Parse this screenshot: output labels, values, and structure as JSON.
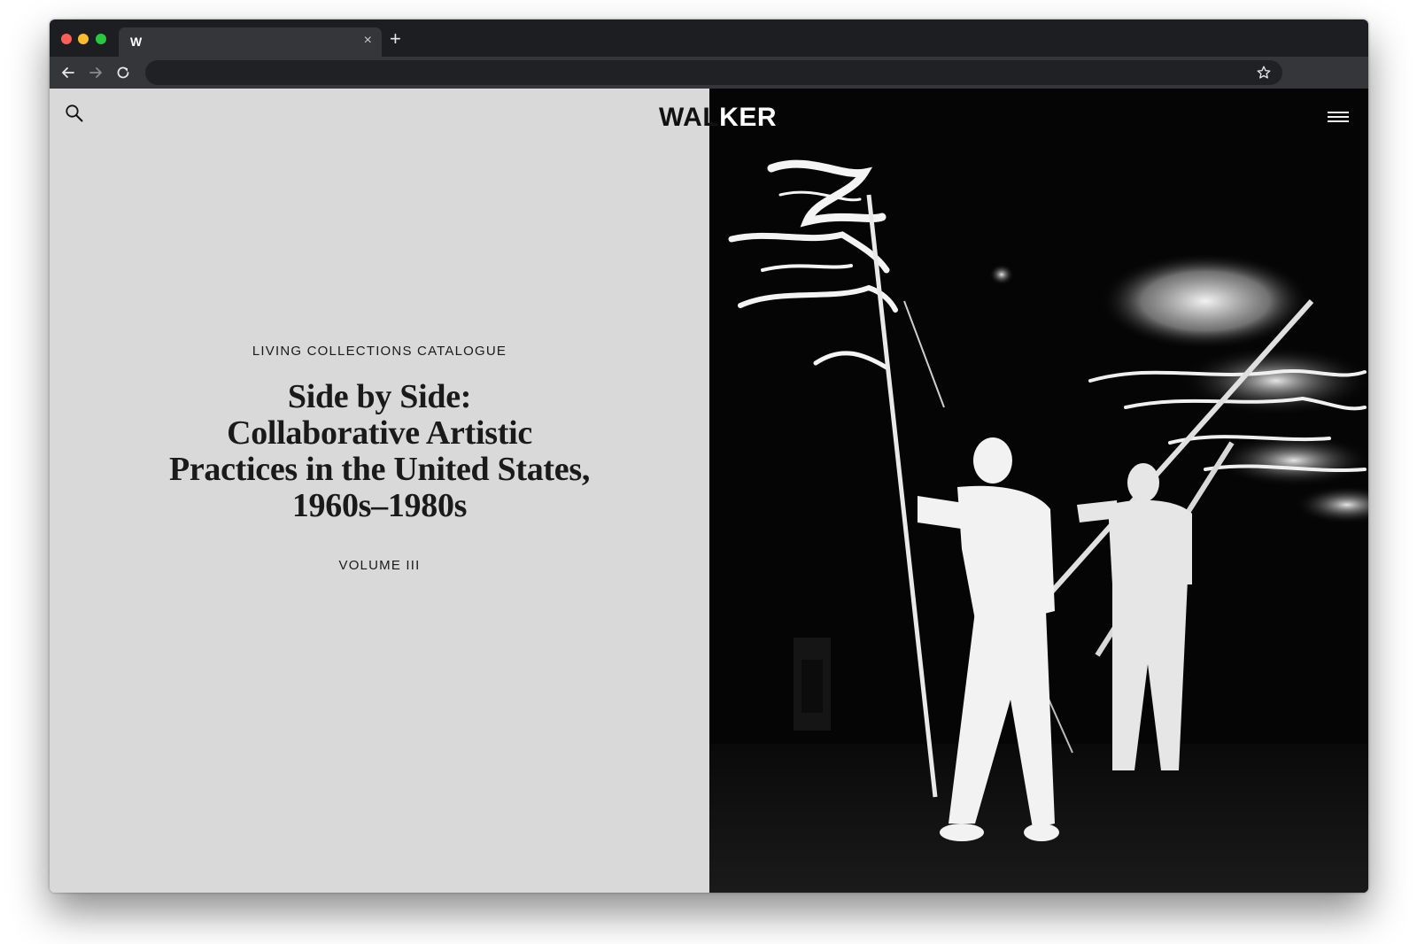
{
  "browser": {
    "tab": {
      "favicon_letter": "W",
      "close_glyph": "×"
    },
    "new_tab_glyph": "+",
    "address_bar": {
      "value": ""
    },
    "colors": {
      "close": "#fd5f57",
      "minimize": "#fdbc2e",
      "maximize": "#28c840",
      "chrome": "#1d1e21",
      "toolbar": "#34363a"
    },
    "icons": [
      "back-arrow-icon",
      "forward-arrow-icon",
      "reload-icon",
      "star-icon"
    ]
  },
  "header": {
    "logo_left": "WAL",
    "logo_right": "KER",
    "icons": [
      "search-icon",
      "hamburger-menu-icon"
    ]
  },
  "hero": {
    "eyebrow": "LIVING COLLECTIONS CATALOGUE",
    "title_lines": [
      "Side by Side:",
      "Collaborative Artistic",
      "Practices in the United States,",
      "1960s–1980s"
    ],
    "volume": "VOLUME III",
    "background_color": "#d9d9d9"
  },
  "photo": {
    "description_icon": "performance-photo-image",
    "background_color": "#000000"
  }
}
